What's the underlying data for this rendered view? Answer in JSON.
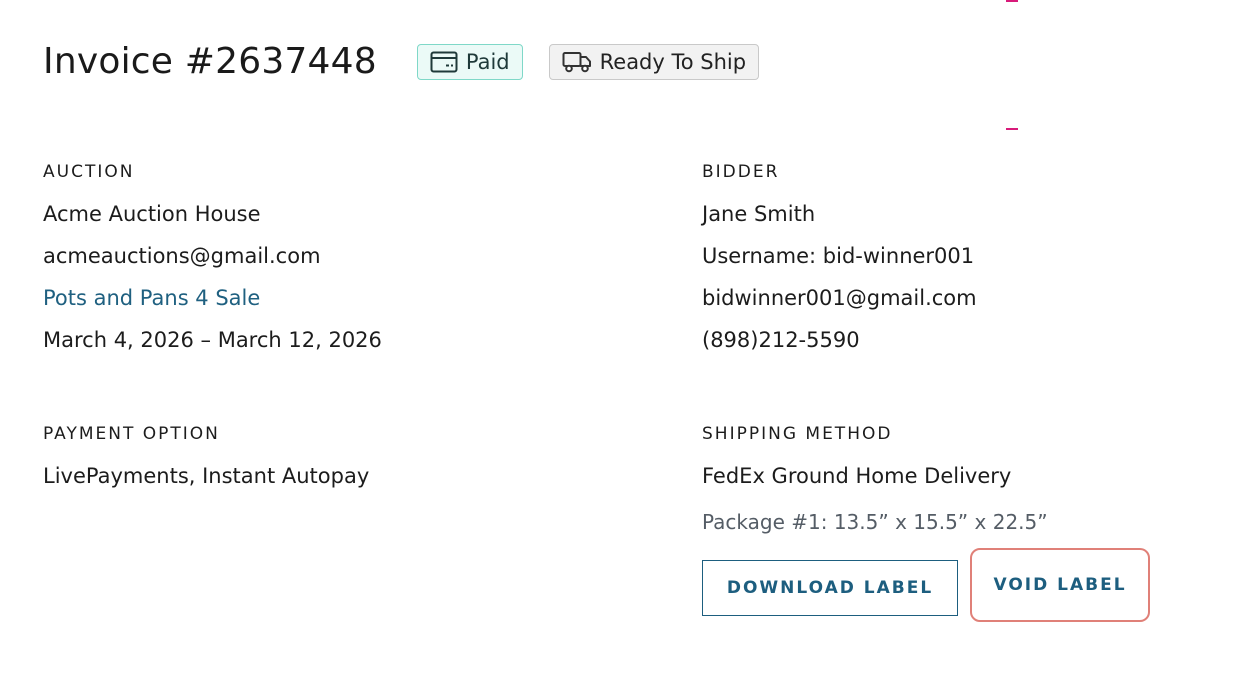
{
  "header": {
    "invoice_title": "Invoice #2637448",
    "paid_badge": "Paid",
    "ship_badge": "Ready To Ship"
  },
  "auction": {
    "heading": "AUCTION",
    "house": "Acme Auction House",
    "email": "acmeauctions@gmail.com",
    "sale_link": "Pots and Pans 4 Sale",
    "dates": "March 4, 2026 – March 12, 2026"
  },
  "bidder": {
    "heading": "BIDDER",
    "name": "Jane Smith",
    "username": "Username: bid-winner001",
    "email": "bidwinner001@gmail.com",
    "phone": "(898)212-5590"
  },
  "payment": {
    "heading": "PAYMENT OPTION",
    "value": "LivePayments, Instant Autopay"
  },
  "shipping": {
    "heading": "SHIPPING METHOD",
    "method": "FedEx Ground Home Delivery",
    "package": "Package #1: 13.5” x 15.5” x 22.5”",
    "download_label": "DOWNLOAD LABEL",
    "void_label": "VOID LABEL"
  },
  "colors": {
    "link": "#1f6080",
    "button": "#1d5e7f",
    "paid_border": "#7fd8c8",
    "void_highlight": "#e08078"
  },
  "icons": {
    "paid": "credit-card-icon",
    "ship": "truck-icon"
  }
}
